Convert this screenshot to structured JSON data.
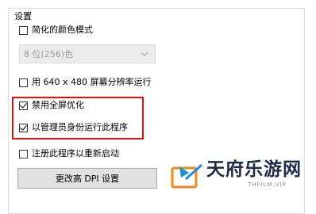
{
  "group": {
    "title": "设置"
  },
  "options": {
    "reduced_color": {
      "label": "简化的颜色模式",
      "checked": false
    },
    "color_select": {
      "value": "8 位(256)色"
    },
    "resolution_640": {
      "label": "用 640 x 480 屏幕分辨率运行",
      "checked": false
    },
    "disable_fullscreen": {
      "label": "禁用全屏优化",
      "checked": true
    },
    "run_as_admin": {
      "label": "以管理员身份运行此程序",
      "checked": true
    },
    "register_restart": {
      "label": "注册此程序以重新启动",
      "checked": false
    }
  },
  "dpi_button": {
    "label": "更改高 DPI 设置"
  },
  "watermark": {
    "title": "天府乐游网",
    "subtitle": "THFILM.VIP"
  },
  "colors": {
    "highlight": "#e01111",
    "text": "#000000",
    "disabled_text": "#9a9a9a",
    "button_bg": "#e1e1e1",
    "watermark_orange": "#f08a1c",
    "watermark_blue": "#1f8fd6",
    "watermark_text": "#1c2a4a"
  }
}
